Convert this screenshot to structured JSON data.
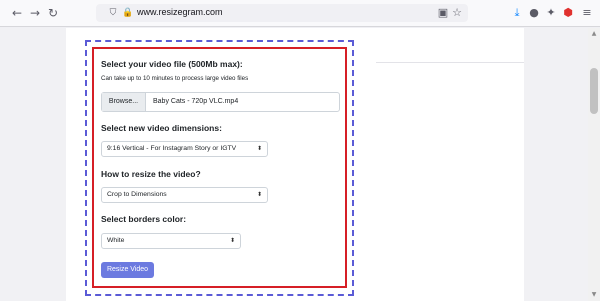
{
  "browser": {
    "url": "www.resizegram.com",
    "icons": [
      "back-arrow-icon",
      "forward-arrow-icon",
      "reload-icon",
      "shield-icon",
      "lock-icon",
      "reader-view-icon",
      "bookmark-star-icon",
      "download-icon",
      "account-icon",
      "extensions-icon",
      "ublock-icon",
      "menu-icon"
    ]
  },
  "form": {
    "file_label": "Select your video file (500Mb max):",
    "file_hint": "Can take up to 10 minutes to process large video files",
    "browse_label": "Browse...",
    "file_name": "Baby Cats - 720p VLC.mp4",
    "dimensions_label": "Select new video dimensions:",
    "dimensions_value": "9:16 Vertical - For Instagram Story or IGTV",
    "resize_label": "How to resize the video?",
    "resize_value": "Crop to Dimensions",
    "borders_label": "Select borders color:",
    "borders_value": "White",
    "submit_label": "Resize Video"
  },
  "colors": {
    "dashed_border": "#5b5bd6",
    "highlight_border": "#d61f26",
    "submit_bg": "#6c7ae0"
  }
}
